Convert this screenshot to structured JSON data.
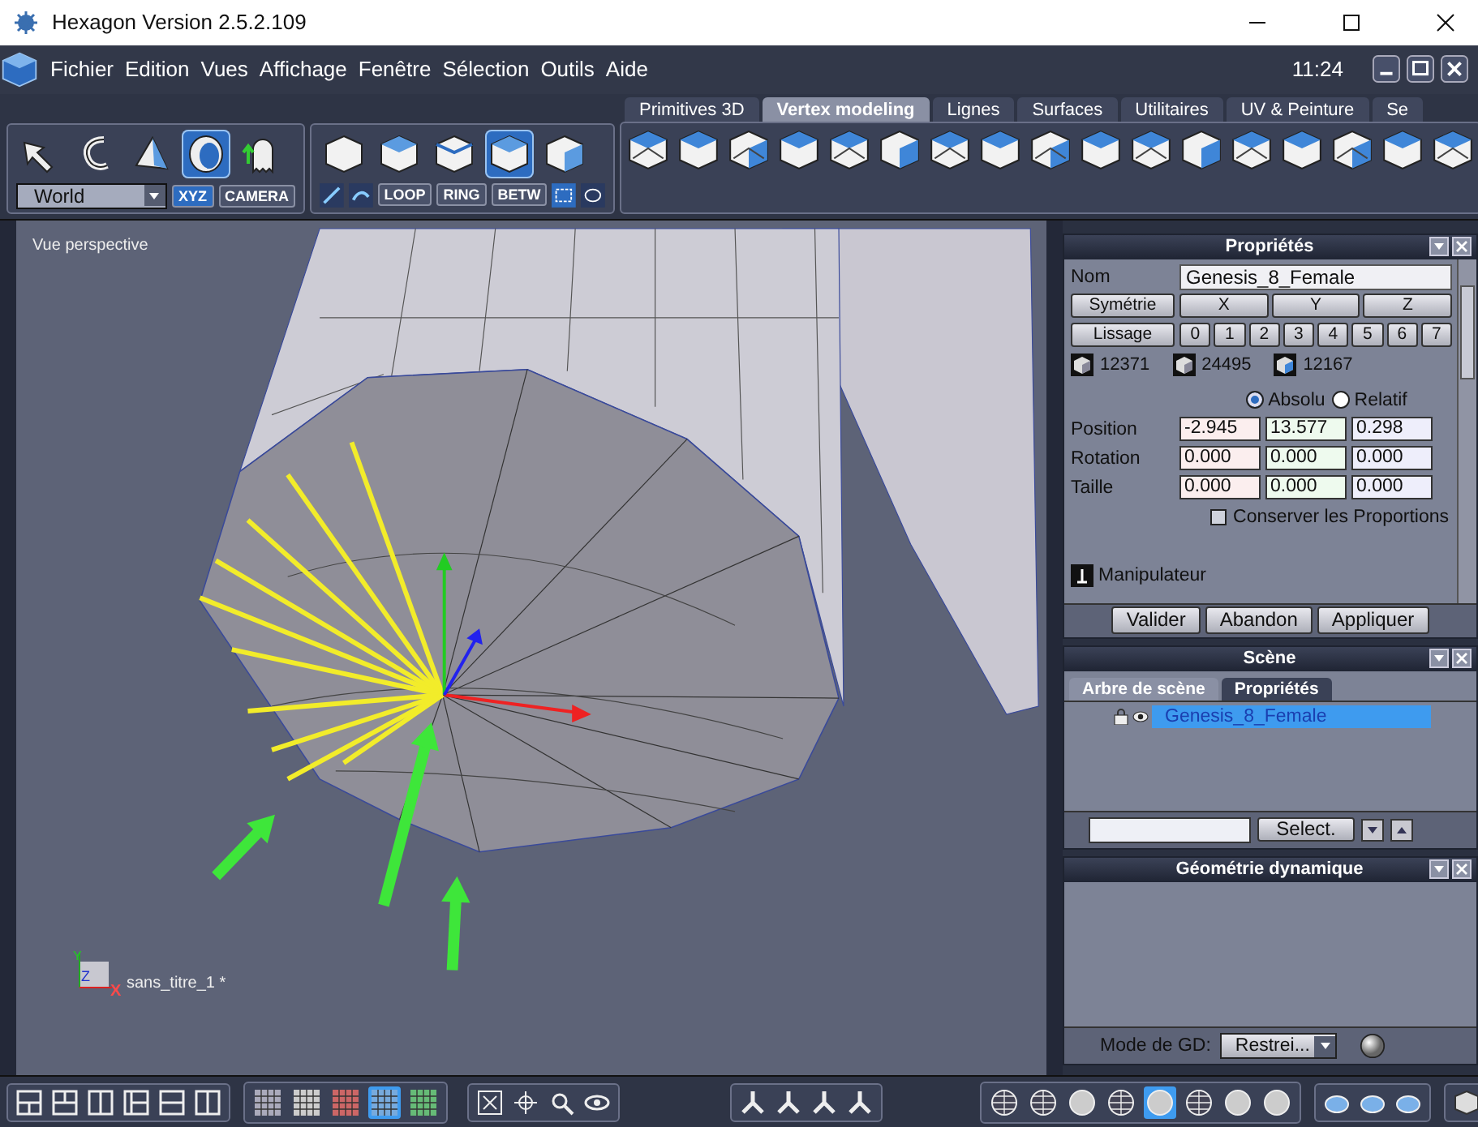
{
  "window": {
    "title": "Hexagon Version 2.5.2.109"
  },
  "menu": [
    "Fichier",
    "Edition",
    "Vues",
    "Affichage",
    "Fenêtre",
    "Sélection",
    "Outils",
    "Aide"
  ],
  "clock": "11:24",
  "tool_tabs": [
    {
      "label": "Primitives 3D",
      "selected": false
    },
    {
      "label": "Vertex modeling",
      "selected": true
    },
    {
      "label": "Lignes",
      "selected": false
    },
    {
      "label": "Surfaces",
      "selected": false
    },
    {
      "label": "Utilitaires",
      "selected": false
    },
    {
      "label": "UV & Peinture",
      "selected": false
    },
    {
      "label": "Se",
      "selected": false
    }
  ],
  "select_tools": [
    {
      "selected": false
    },
    {
      "selected": false
    },
    {
      "selected": false
    },
    {
      "selected": true
    },
    {
      "selected": false
    }
  ],
  "space": {
    "value": "World",
    "modes": [
      {
        "label": "XYZ",
        "selected": true
      },
      {
        "label": "CAMERA",
        "selected": false
      }
    ]
  },
  "component_modes": [
    {
      "selected": false
    },
    {
      "selected": false
    },
    {
      "selected": false
    },
    {
      "selected": true
    },
    {
      "selected": false
    }
  ],
  "selection_buttons": [
    "LOOP",
    "RING",
    "BETW"
  ],
  "viewport": {
    "label": "Vue perspective",
    "document": "sans_titre_1 *",
    "axis_labels": [
      "Y",
      "Z",
      "X"
    ]
  },
  "properties": {
    "title": "Propriétés",
    "name_label": "Nom",
    "name_value": "Genesis_8_Female",
    "symmetry": {
      "label": "Symétrie",
      "axes": [
        "X",
        "Y",
        "Z"
      ]
    },
    "smoothing": {
      "label": "Lissage",
      "levels": [
        "0",
        "1",
        "2",
        "3",
        "4",
        "5",
        "6",
        "7"
      ]
    },
    "counts": [
      "12371",
      "24495",
      "12167"
    ],
    "coord_modes": [
      {
        "label": "Absolu",
        "selected": true
      },
      {
        "label": "Relatif",
        "selected": false
      }
    ],
    "transforms": [
      {
        "label": "Position",
        "values": [
          "-2.945",
          "13.577",
          "0.298"
        ]
      },
      {
        "label": "Rotation",
        "values": [
          "0.000",
          "0.000",
          "0.000"
        ]
      },
      {
        "label": "Taille",
        "values": [
          "0.000",
          "0.000",
          "0.000"
        ]
      }
    ],
    "keep_proportions": {
      "label": "Conserver les Proportions",
      "checked": false
    },
    "manipulator": "Manipulateur",
    "buttons": [
      "Valider",
      "Abandon",
      "Appliquer"
    ]
  },
  "scene": {
    "title": "Scène",
    "tabs": [
      {
        "label": "Arbre de scène",
        "selected": true
      },
      {
        "label": "Propriétés",
        "selected": false
      }
    ],
    "items": [
      {
        "label": "Genesis_8_Female",
        "selected": true
      }
    ],
    "select_button": "Select."
  },
  "dyn_geometry": {
    "title": "Géométrie dynamique",
    "mode_label": "Mode de GD:",
    "mode_value": "Restrei..."
  },
  "bottom_toolbar": {
    "display_modes": [
      {
        "selected": false
      },
      {
        "selected": false
      },
      {
        "selected": false
      },
      {
        "selected": true
      },
      {
        "selected": false
      }
    ],
    "shading_modes": [
      {
        "selected": false
      },
      {
        "selected": false
      },
      {
        "selected": false
      },
      {
        "selected": false
      },
      {
        "selected": true
      },
      {
        "selected": false
      },
      {
        "selected": false
      },
      {
        "selected": false
      }
    ]
  }
}
